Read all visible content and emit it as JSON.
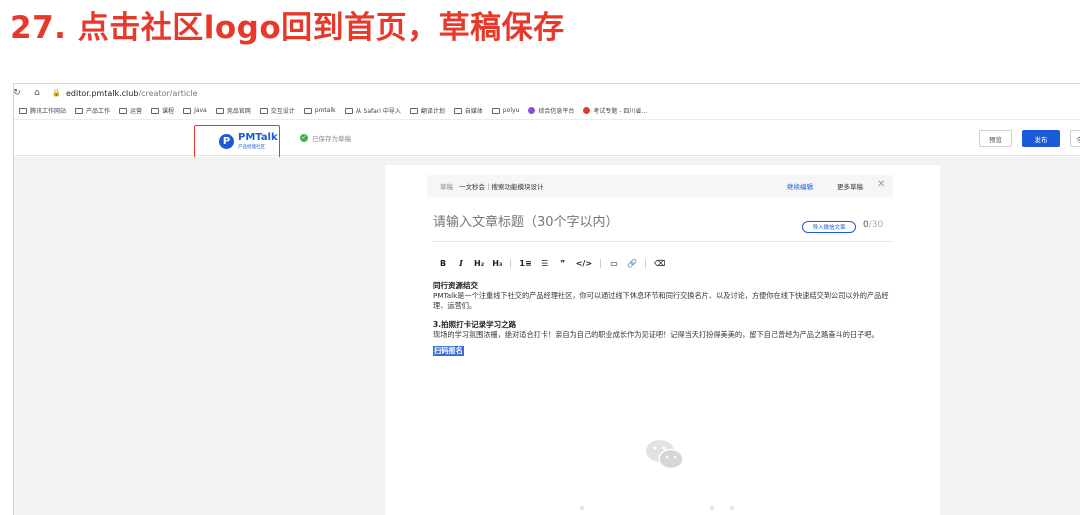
{
  "slide": {
    "title": "27. 点击社区logo回到首页，草稿保存"
  },
  "browser": {
    "url_host": "editor.pmtalk.club",
    "url_path": "/creator/article",
    "bookmarks": [
      {
        "label": "腾讯工作网站",
        "type": "folder"
      },
      {
        "label": "产品工作",
        "type": "folder"
      },
      {
        "label": "运营",
        "type": "folder"
      },
      {
        "label": "课程",
        "type": "folder"
      },
      {
        "label": "Java",
        "type": "folder"
      },
      {
        "label": "竞品官网",
        "type": "folder"
      },
      {
        "label": "交互设计",
        "type": "folder"
      },
      {
        "label": "pmtalk",
        "type": "folder"
      },
      {
        "label": "从 Safari 中导入",
        "type": "folder"
      },
      {
        "label": "翻译计划",
        "type": "folder"
      },
      {
        "label": "自媒体",
        "type": "folder"
      },
      {
        "label": "polyu",
        "type": "folder"
      },
      {
        "label": "综合信息平台",
        "type": "site",
        "color": "#8a4fd8"
      },
      {
        "label": "考试专题 - 四川省...",
        "type": "site",
        "color": "#e23b2e"
      }
    ]
  },
  "appbar": {
    "logo_text": "PMTalk",
    "logo_sub": "产品经理社区",
    "logo_letter": "P",
    "saved_status": "已保存为草稿",
    "preview_label": "预览",
    "publish_label": "发布",
    "extra_label": "今"
  },
  "draft_bar": {
    "tag": "草稿",
    "title": "一文秒会｜搜索功能模块设计",
    "continue_label": "继续编辑",
    "more_label": "更多草稿",
    "close": "✕"
  },
  "editor": {
    "title_placeholder": "请输入文章标题（30个字以内）",
    "import_label": "导入微信文章",
    "count_current": "0",
    "count_max": "/30",
    "toolbar": [
      "B",
      "I",
      "H₂",
      "H₃",
      "|",
      "1≡",
      "☰",
      "❞",
      "</>",
      "|",
      "▭",
      "🔗",
      "|",
      "⌫"
    ],
    "paragraphs": {
      "h1": "同行资源结交",
      "p1": "PMTalk是一个注重线下社交的产品经理社区，你可以通过线下休息环节和同行交换名片、以及讨论，方便你在线下快速结交到公司以外的产品经理、运营们。",
      "h2": "3.拍照打卡记录学习之路",
      "p2": "现场的学习氛围浓栅，绝对适合打卡！亲自为自己的职业成长作为见证吧！记得当天打扮得美美的，留下自己曾经为产品之路奋斗的日子吧。",
      "highlight": "扫码报名"
    }
  },
  "colors": {
    "accent": "#1c5bd8",
    "slide_title": "#e8382a",
    "highlight_box": "#e8382a"
  }
}
